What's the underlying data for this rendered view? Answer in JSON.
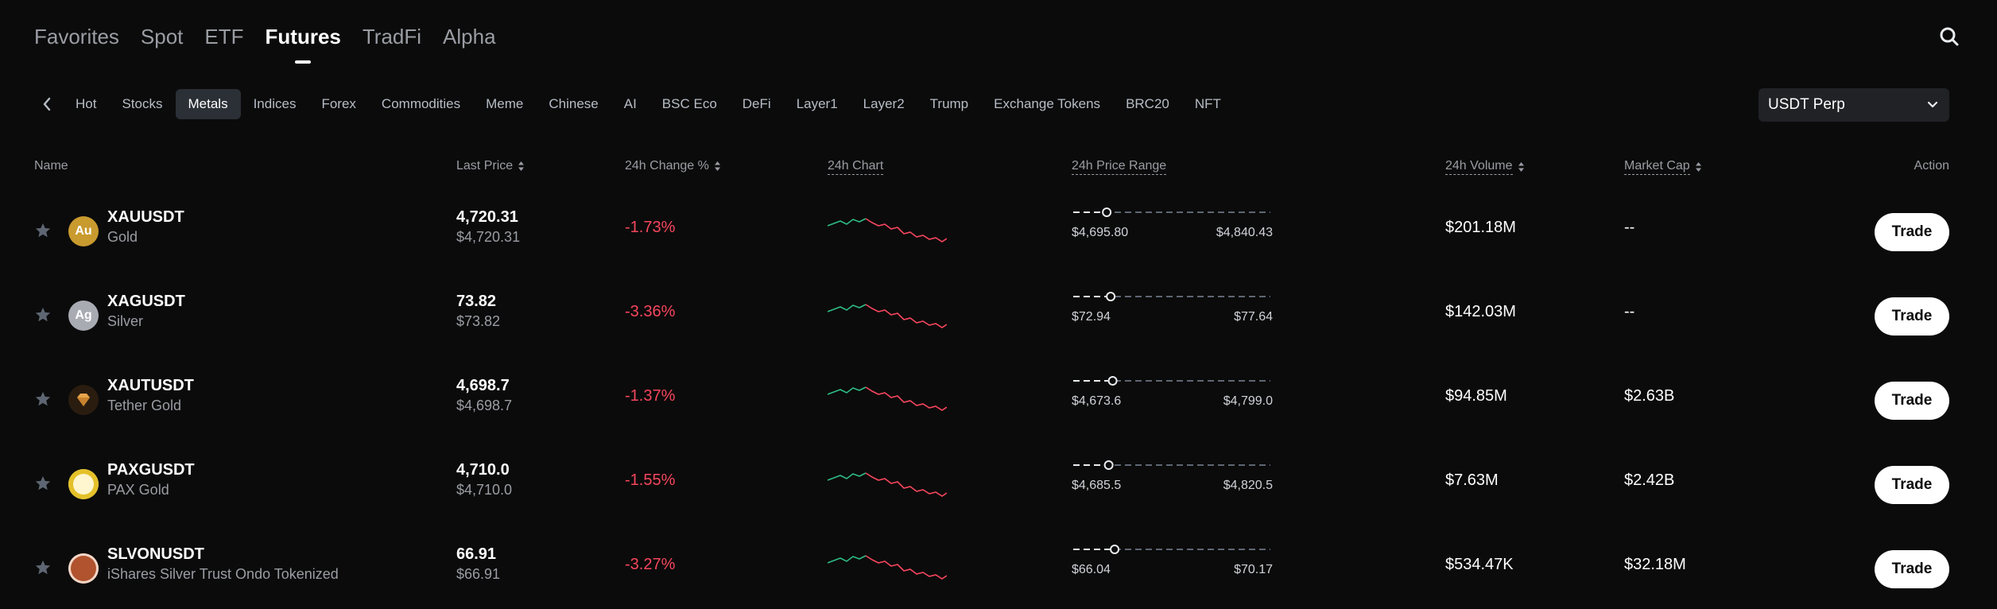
{
  "top_tabs": [
    {
      "label": "Favorites",
      "active": false
    },
    {
      "label": "Spot",
      "active": false
    },
    {
      "label": "ETF",
      "active": false
    },
    {
      "label": "Futures",
      "active": true
    },
    {
      "label": "TradFi",
      "active": false
    },
    {
      "label": "Alpha",
      "active": false
    }
  ],
  "sub_tabs": [
    {
      "label": "Hot",
      "active": false
    },
    {
      "label": "Stocks",
      "active": false
    },
    {
      "label": "Metals",
      "active": true
    },
    {
      "label": "Indices",
      "active": false
    },
    {
      "label": "Forex",
      "active": false
    },
    {
      "label": "Commodities",
      "active": false
    },
    {
      "label": "Meme",
      "active": false
    },
    {
      "label": "Chinese",
      "active": false
    },
    {
      "label": "AI",
      "active": false
    },
    {
      "label": "BSC Eco",
      "active": false
    },
    {
      "label": "DeFi",
      "active": false
    },
    {
      "label": "Layer1",
      "active": false
    },
    {
      "label": "Layer2",
      "active": false
    },
    {
      "label": "Trump",
      "active": false
    },
    {
      "label": "Exchange Tokens",
      "active": false
    },
    {
      "label": "BRC20",
      "active": false
    },
    {
      "label": "NFT",
      "active": false
    }
  ],
  "contract_select": {
    "value": "USDT Perp"
  },
  "table": {
    "headers": {
      "name": "Name",
      "last_price": "Last Price",
      "change": "24h Change %",
      "chart": "24h Chart",
      "range": "24h Price Range",
      "volume": "24h Volume",
      "market_cap": "Market Cap",
      "action": "Action"
    },
    "rows": [
      {
        "symbol": "XAUUSDT",
        "name": "Gold",
        "icon": "gold-coin-icon",
        "icon_text": "Au",
        "icon_color": "#c99a2e",
        "last_price": "4,720.31",
        "price_usd": "$4,720.31",
        "change": "-1.73%",
        "range_low": "$4,695.80",
        "range_high": "$4,840.43",
        "range_position": 0.17,
        "volume": "$201.18M",
        "market_cap": "--",
        "trade_label": "Trade"
      },
      {
        "symbol": "XAGUSDT",
        "name": "Silver",
        "icon": "silver-coin-icon",
        "icon_text": "Ag",
        "icon_color": "#a9abb3",
        "last_price": "73.82",
        "price_usd": "$73.82",
        "change": "-3.36%",
        "range_low": "$72.94",
        "range_high": "$77.64",
        "range_position": 0.19,
        "volume": "$142.03M",
        "market_cap": "--",
        "trade_label": "Trade"
      },
      {
        "symbol": "XAUTUSDT",
        "name": "Tether Gold",
        "icon": "tether-gold-icon",
        "icon_text": "",
        "icon_color": "#2a1d10",
        "last_price": "4,698.7",
        "price_usd": "$4,698.7",
        "change": "-1.37%",
        "range_low": "$4,673.6",
        "range_high": "$4,799.0",
        "range_position": 0.2,
        "volume": "$94.85M",
        "market_cap": "$2.63B",
        "trade_label": "Trade"
      },
      {
        "symbol": "PAXGUSDT",
        "name": "PAX Gold",
        "icon": "pax-gold-icon",
        "icon_text": "",
        "icon_color": "#e4c12a",
        "last_price": "4,710.0",
        "price_usd": "$4,710.0",
        "change": "-1.55%",
        "range_low": "$4,685.5",
        "range_high": "$4,820.5",
        "range_position": 0.18,
        "volume": "$7.63M",
        "market_cap": "$2.42B",
        "trade_label": "Trade"
      },
      {
        "symbol": "SLVONUSDT",
        "name": "iShares Silver Trust Ondo Tokenized",
        "icon": "ishares-icon",
        "icon_text": "",
        "icon_color": "#b0532e",
        "last_price": "66.91",
        "price_usd": "$66.91",
        "change": "-3.27%",
        "range_low": "$66.04",
        "range_high": "$70.17",
        "range_position": 0.21,
        "volume": "$534.47K",
        "market_cap": "$32.18M",
        "trade_label": "Trade"
      }
    ]
  },
  "colors": {
    "up": "#2ebd85",
    "down": "#f6465d",
    "accent": "#ffffff"
  }
}
